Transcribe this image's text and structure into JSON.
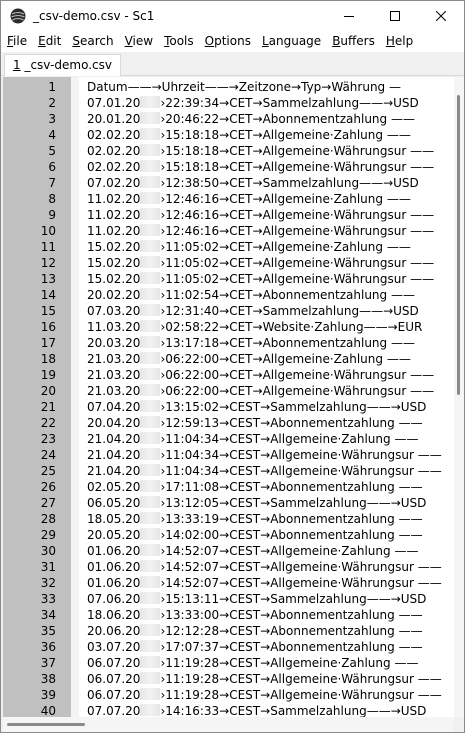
{
  "window": {
    "title": "_csv-demo.csv - Sc1"
  },
  "menu": [
    {
      "acc": "F",
      "rest": "ile"
    },
    {
      "acc": "E",
      "rest": "dit"
    },
    {
      "acc": "S",
      "rest": "earch"
    },
    {
      "acc": "V",
      "rest": "iew"
    },
    {
      "acc": "T",
      "rest": "ools"
    },
    {
      "acc": "O",
      "rest": "ptions"
    },
    {
      "acc": "L",
      "rest": "anguage"
    },
    {
      "acc": "B",
      "rest": "uffers"
    },
    {
      "acc": "H",
      "rest": "elp"
    }
  ],
  "tab": {
    "acc": "1",
    "label": " _csv-demo.csv"
  },
  "editor": {
    "header": [
      "Datum",
      "Uhrzeit",
      "Zeitzone",
      "Typ",
      "Währung"
    ],
    "rows": [
      {
        "d": "07.01.20",
        "t": "22:39:34",
        "z": "CET",
        "typ": "Sammelzahlung",
        "w": "USD"
      },
      {
        "d": "20.01.20",
        "t": "20:46:22",
        "z": "CET",
        "typ": "Abonnementzahlung",
        "w": ""
      },
      {
        "d": "02.02.20",
        "t": "15:18:18",
        "z": "CET",
        "typ": "Allgemeine·Zahlung",
        "w": ""
      },
      {
        "d": "02.02.20",
        "t": "15:18:18",
        "z": "CET",
        "typ": "Allgemeine·Währungsur",
        "w": ""
      },
      {
        "d": "02.02.20",
        "t": "15:18:18",
        "z": "CET",
        "typ": "Allgemeine·Währungsur",
        "w": ""
      },
      {
        "d": "07.02.20",
        "t": "12:38:50",
        "z": "CET",
        "typ": "Sammelzahlung",
        "w": "USD"
      },
      {
        "d": "11.02.20",
        "t": "12:46:16",
        "z": "CET",
        "typ": "Allgemeine·Zahlung",
        "w": ""
      },
      {
        "d": "11.02.20",
        "t": "12:46:16",
        "z": "CET",
        "typ": "Allgemeine·Währungsur",
        "w": ""
      },
      {
        "d": "11.02.20",
        "t": "12:46:16",
        "z": "CET",
        "typ": "Allgemeine·Währungsur",
        "w": ""
      },
      {
        "d": "15.02.20",
        "t": "11:05:02",
        "z": "CET",
        "typ": "Allgemeine·Zahlung",
        "w": ""
      },
      {
        "d": "15.02.20",
        "t": "11:05:02",
        "z": "CET",
        "typ": "Allgemeine·Währungsur",
        "w": ""
      },
      {
        "d": "15.02.20",
        "t": "11:05:02",
        "z": "CET",
        "typ": "Allgemeine·Währungsur",
        "w": ""
      },
      {
        "d": "20.02.20",
        "t": "11:02:54",
        "z": "CET",
        "typ": "Abonnementzahlung",
        "w": ""
      },
      {
        "d": "07.03.20",
        "t": "12:31:40",
        "z": "CET",
        "typ": "Sammelzahlung",
        "w": "USD"
      },
      {
        "d": "11.03.20",
        "t": "02:58:22",
        "z": "CET",
        "typ": "Website·Zahlung",
        "w": "EUR"
      },
      {
        "d": "20.03.20",
        "t": "13:17:18",
        "z": "CET",
        "typ": "Abonnementzahlung",
        "w": ""
      },
      {
        "d": "21.03.20",
        "t": "06:22:00",
        "z": "CET",
        "typ": "Allgemeine·Zahlung",
        "w": ""
      },
      {
        "d": "21.03.20",
        "t": "06:22:00",
        "z": "CET",
        "typ": "Allgemeine·Währungsur",
        "w": ""
      },
      {
        "d": "21.03.20",
        "t": "06:22:00",
        "z": "CET",
        "typ": "Allgemeine·Währungsur",
        "w": ""
      },
      {
        "d": "07.04.20",
        "t": "13:15:02",
        "z": "CEST",
        "typ": "Sammelzahlung",
        "w": "USD"
      },
      {
        "d": "20.04.20",
        "t": "12:59:13",
        "z": "CEST",
        "typ": "Abonnementzahlung",
        "w": ""
      },
      {
        "d": "21.04.20",
        "t": "11:04:34",
        "z": "CEST",
        "typ": "Allgemeine·Zahlung",
        "w": ""
      },
      {
        "d": "21.04.20",
        "t": "11:04:34",
        "z": "CEST",
        "typ": "Allgemeine·Währungsur",
        "w": ""
      },
      {
        "d": "21.04.20",
        "t": "11:04:34",
        "z": "CEST",
        "typ": "Allgemeine·Währungsur",
        "w": ""
      },
      {
        "d": "02.05.20",
        "t": "17:11:08",
        "z": "CEST",
        "typ": "Abonnementzahlung",
        "w": ""
      },
      {
        "d": "06.05.20",
        "t": "13:12:05",
        "z": "CEST",
        "typ": "Sammelzahlung",
        "w": "USD"
      },
      {
        "d": "18.05.20",
        "t": "13:33:19",
        "z": "CEST",
        "typ": "Abonnementzahlung",
        "w": ""
      },
      {
        "d": "20.05.20",
        "t": "14:02:00",
        "z": "CEST",
        "typ": "Abonnementzahlung",
        "w": ""
      },
      {
        "d": "01.06.20",
        "t": "14:52:07",
        "z": "CEST",
        "typ": "Allgemeine·Zahlung",
        "w": ""
      },
      {
        "d": "01.06.20",
        "t": "14:52:07",
        "z": "CEST",
        "typ": "Allgemeine·Währungsur",
        "w": ""
      },
      {
        "d": "01.06.20",
        "t": "14:52:07",
        "z": "CEST",
        "typ": "Allgemeine·Währungsur",
        "w": ""
      },
      {
        "d": "07.06.20",
        "t": "15:13:11",
        "z": "CEST",
        "typ": "Sammelzahlung",
        "w": "USD"
      },
      {
        "d": "18.06.20",
        "t": "13:33:00",
        "z": "CEST",
        "typ": "Abonnementzahlung",
        "w": ""
      },
      {
        "d": "20.06.20",
        "t": "12:12:28",
        "z": "CEST",
        "typ": "Abonnementzahlung",
        "w": ""
      },
      {
        "d": "03.07.20",
        "t": "17:07:37",
        "z": "CEST",
        "typ": "Abonnementzahlung",
        "w": ""
      },
      {
        "d": "06.07.20",
        "t": "11:19:28",
        "z": "CEST",
        "typ": "Allgemeine·Zahlung",
        "w": ""
      },
      {
        "d": "06.07.20",
        "t": "11:19:28",
        "z": "CEST",
        "typ": "Allgemeine·Währungsur",
        "w": ""
      },
      {
        "d": "06.07.20",
        "t": "11:19:28",
        "z": "CEST",
        "typ": "Allgemeine·Währungsur",
        "w": ""
      },
      {
        "d": "07.07.20",
        "t": "14:16:33",
        "z": "CEST",
        "typ": "Sammelzahlung",
        "w": "USD"
      }
    ]
  }
}
